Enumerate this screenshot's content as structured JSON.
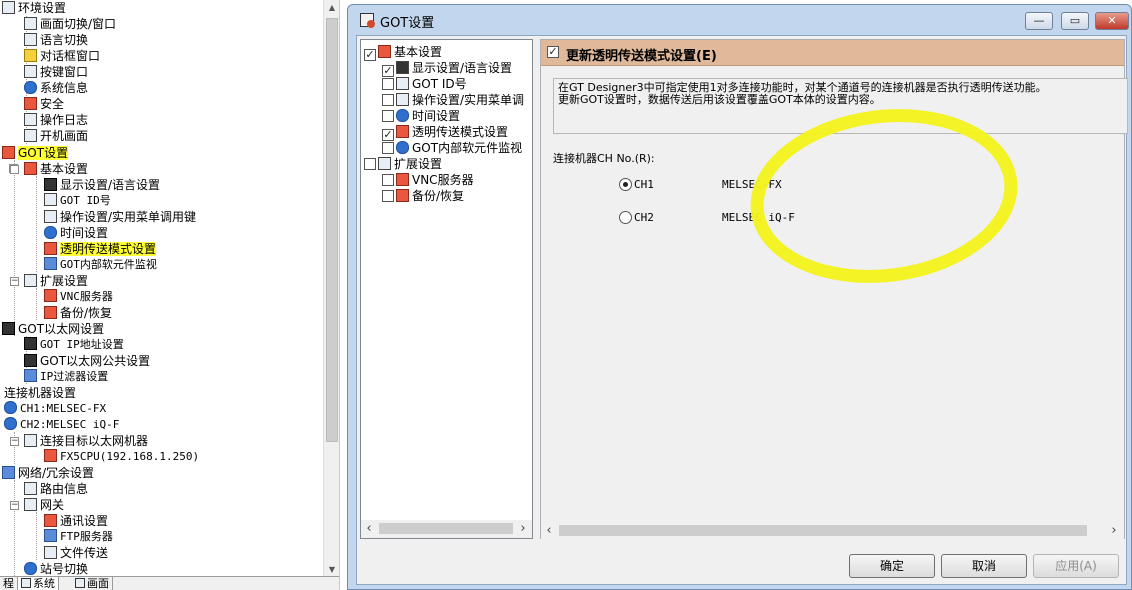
{
  "left_tree": {
    "items": [
      {
        "label": "环境设置"
      },
      {
        "label": "画面切换/窗口"
      },
      {
        "label": "语言切换"
      },
      {
        "label": "对话框窗口"
      },
      {
        "label": "按键窗口"
      },
      {
        "label": "系统信息"
      },
      {
        "label": "安全"
      },
      {
        "label": "操作日志"
      },
      {
        "label": "开机画面"
      },
      {
        "label": "GOT设置"
      },
      {
        "label": "基本设置"
      },
      {
        "label": "显示设置/语言设置"
      },
      {
        "label": "GOT ID号"
      },
      {
        "label": "操作设置/实用菜单调用键"
      },
      {
        "label": "时间设置"
      },
      {
        "label": "透明传送模式设置"
      },
      {
        "label": "GOT内部软元件监视"
      },
      {
        "label": "扩展设置"
      },
      {
        "label": "VNC服务器"
      },
      {
        "label": "备份/恢复"
      },
      {
        "label": "GOT以太网设置"
      },
      {
        "label": "GOT IP地址设置"
      },
      {
        "label": "GOT以太网公共设置"
      },
      {
        "label": "IP过滤器设置"
      },
      {
        "label": "连接机器设置"
      },
      {
        "label": "CH1:MELSEC-FX"
      },
      {
        "label": "CH2:MELSEC iQ-F"
      },
      {
        "label": "连接目标以太网机器"
      },
      {
        "label": "FX5CPU(192.168.1.250)"
      },
      {
        "label": "网络/冗余设置"
      },
      {
        "label": "路由信息"
      },
      {
        "label": "网关"
      },
      {
        "label": "通讯设置"
      },
      {
        "label": "FTP服务器"
      },
      {
        "label": "文件传送"
      },
      {
        "label": "站号切换"
      }
    ]
  },
  "bottom_tabs": [
    {
      "label": "程"
    },
    {
      "label": "系统"
    },
    {
      "label": "画面"
    }
  ],
  "dialog": {
    "title": "GOT设置",
    "window_buttons": {
      "minimize": "—",
      "restore": "▭",
      "close": "✕"
    },
    "tree": [
      {
        "label": "基本设置",
        "checked": true
      },
      {
        "label": "显示设置/语言设置",
        "checked": true
      },
      {
        "label": "GOT ID号",
        "checked": false
      },
      {
        "label": "操作设置/实用菜单调",
        "checked": false
      },
      {
        "label": "时间设置",
        "checked": false
      },
      {
        "label": "透明传送模式设置",
        "checked": true
      },
      {
        "label": "GOT内部软元件监视",
        "checked": false
      },
      {
        "label": "扩展设置",
        "checked": false
      },
      {
        "label": "VNC服务器",
        "checked": false
      },
      {
        "label": "备份/恢复",
        "checked": false
      }
    ],
    "section_title": "更新透明传送模式设置(E)",
    "description_line1": "在GT Designer3中可指定使用1对多连接功能时，对某个通道号的连接机器是否执行透明传送功能。",
    "description_line2": "更新GOT设置时，数据传送后用该设置覆盖GOT本体的设置内容。",
    "channel_label": "连接机器CH No.(R):",
    "channels": [
      {
        "ch": "CH1",
        "model": "MELSEC-FX",
        "selected": true
      },
      {
        "ch": "CH2",
        "model": "MELSEC iQ-F",
        "selected": false
      }
    ],
    "buttons": {
      "ok": "确定",
      "cancel": "取消",
      "apply": "应用(A)"
    }
  },
  "colors": {
    "highlight": "#ffff33",
    "section_header": "#e0b89a",
    "dialog_frame": "#c2d7ee",
    "annotation_ellipse": "#f2f21a"
  }
}
